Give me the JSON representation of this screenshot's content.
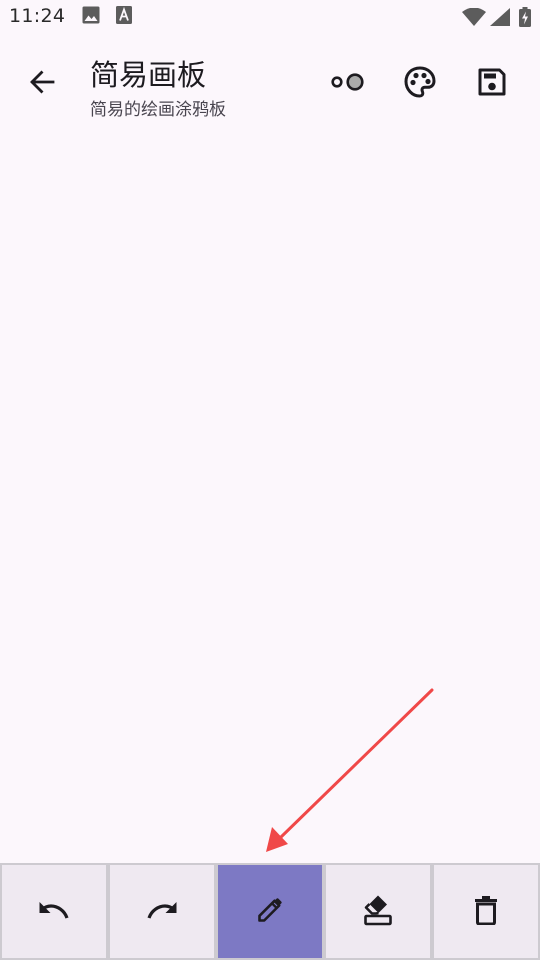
{
  "status_bar": {
    "time": "11:24",
    "icons": [
      "image-icon",
      "text-a-icon",
      "wifi-icon",
      "signal-icon",
      "battery-charging-icon"
    ]
  },
  "app_bar": {
    "title": "简易画板",
    "subtitle": "简易的绘画涂鸦板",
    "actions": [
      "brush-size-icon",
      "palette-icon",
      "save-icon"
    ]
  },
  "toolbar": {
    "tools": [
      {
        "name": "undo",
        "icon": "undo-icon",
        "active": false
      },
      {
        "name": "redo",
        "icon": "redo-icon",
        "active": false
      },
      {
        "name": "pen",
        "icon": "pencil-icon",
        "active": true
      },
      {
        "name": "eraser",
        "icon": "eraser-icon",
        "active": false
      },
      {
        "name": "clear",
        "icon": "trash-icon",
        "active": false
      }
    ]
  },
  "colors": {
    "background": "#fcf7fc",
    "toolbar_button": "#efe9f1",
    "toolbar_active": "#7d79c4",
    "annotation_arrow": "#f04848"
  }
}
